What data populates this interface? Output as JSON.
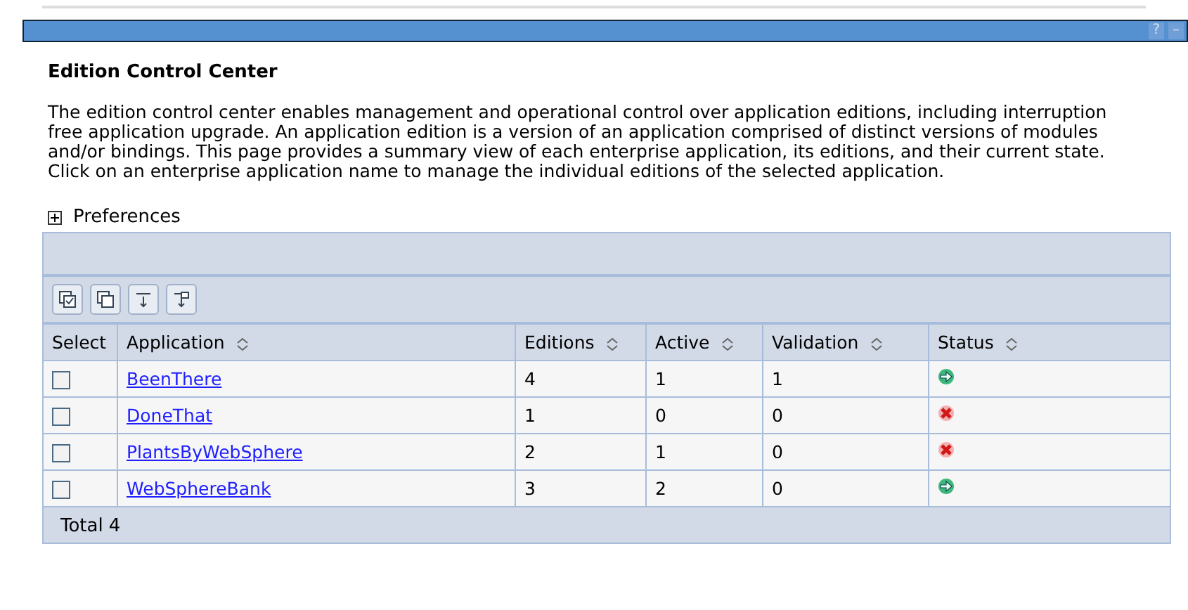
{
  "header_bar": {
    "help": "?",
    "minimize": "–"
  },
  "title": "Edition Control Center",
  "description": "The edition control center enables management and operational control over application editions, including interruption free application upgrade. An application edition is a version of an application comprised of distinct versions of modules and/or bindings.  This page provides a summary view of each enterprise application, its editions, and their current state.  Click on an enterprise application name to manage the individual editions of the selected application.",
  "preferences": {
    "label": "Preferences",
    "expanded": false
  },
  "table": {
    "columns": [
      "Select",
      "Application",
      "Editions",
      "Active",
      "Validation",
      "Status"
    ],
    "rows": [
      {
        "checked": false,
        "application": "BeenThere",
        "editions": "4",
        "active": "1",
        "validation": "1",
        "kind": "ok"
      },
      {
        "checked": false,
        "application": "DoneThat",
        "editions": "1",
        "active": "0",
        "validation": "0",
        "kind": "error"
      },
      {
        "checked": false,
        "application": "PlantsByWebSphere",
        "editions": "2",
        "active": "1",
        "validation": "0",
        "kind": "error"
      },
      {
        "checked": false,
        "application": "WebSphereBank",
        "editions": "3",
        "active": "2",
        "validation": "0",
        "kind": "ok"
      }
    ],
    "total_label": "Total",
    "total_value": "4"
  }
}
